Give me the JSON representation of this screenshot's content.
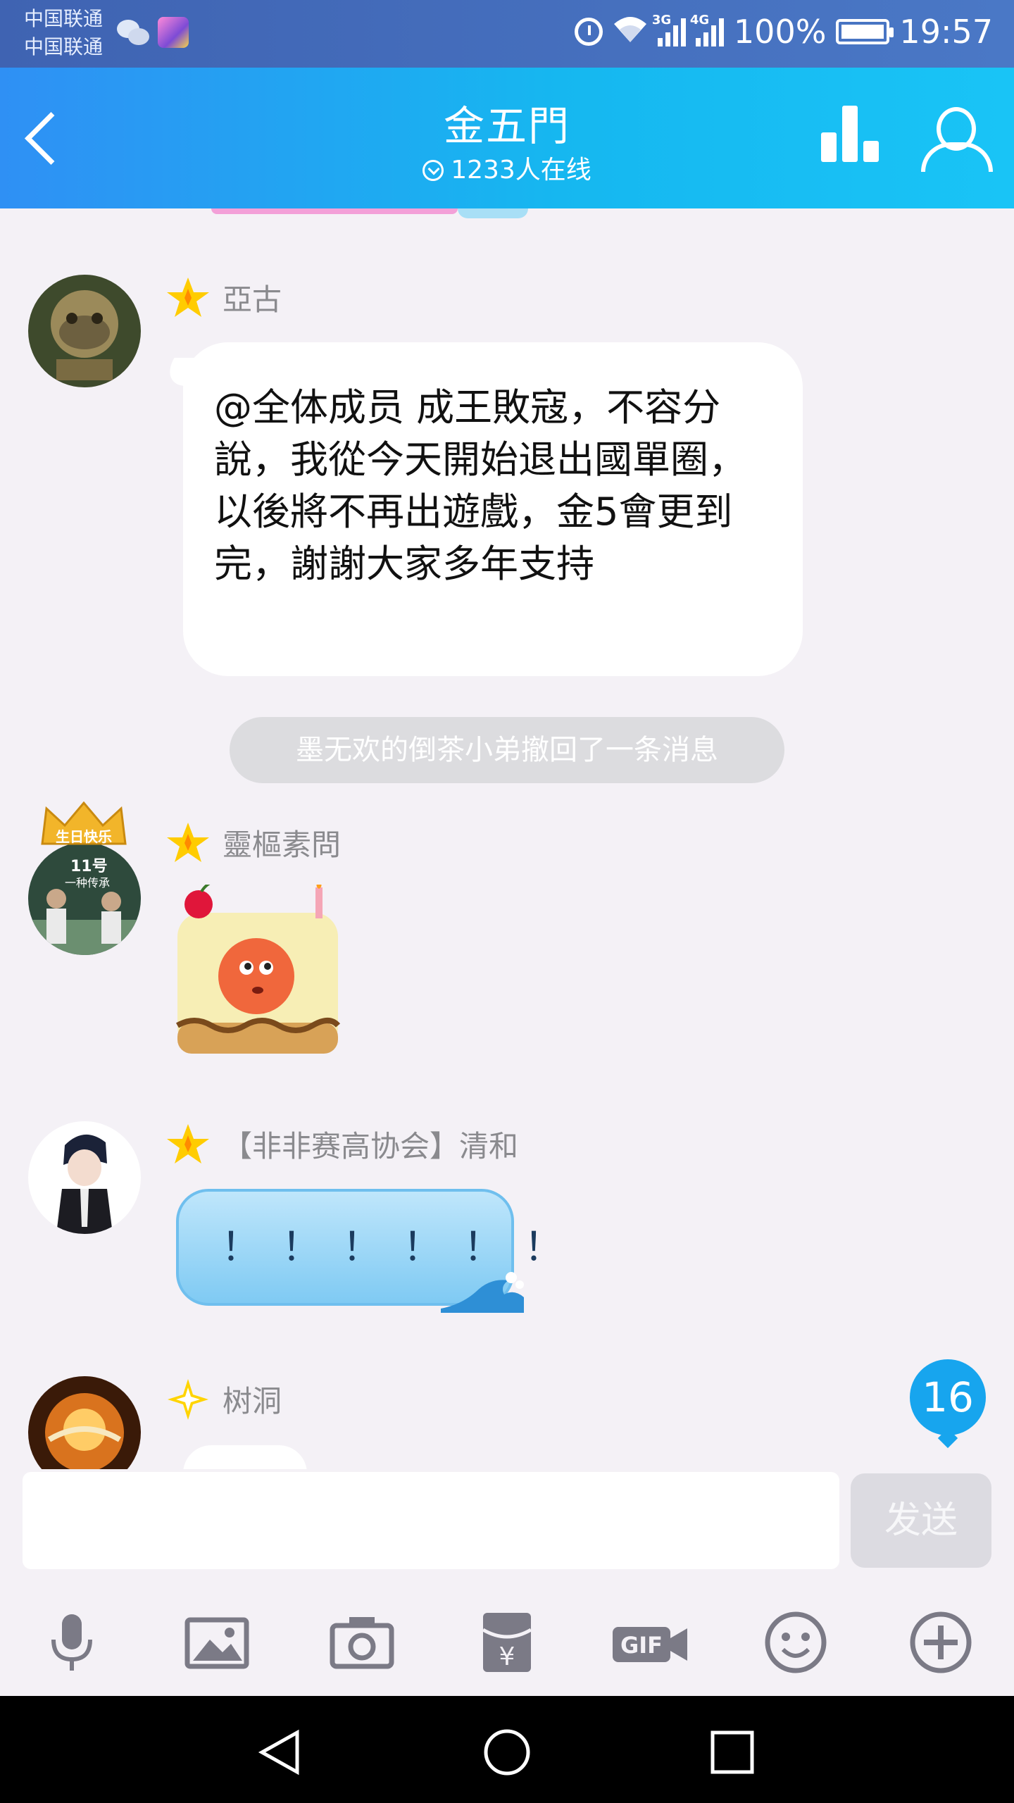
{
  "status_bar": {
    "carrier_1": "中国联通",
    "carrier_2": "中国联通",
    "signal_3g": "3G",
    "signal_4g": "4G",
    "battery": "100%",
    "time": "19:57"
  },
  "header": {
    "title": "金五門",
    "online": "1233人在线"
  },
  "messages": [
    {
      "nickname": "亞古",
      "text": "@全体成员 成王敗寇，不容分說，我從今天開始退出國單圈，以後將不再出遊戲，金5會更到完，謝謝大家多年支持"
    },
    {
      "system_notice": "墨无欢的倒茶小弟撤回了一条消息"
    },
    {
      "nickname": "靈樞素問",
      "avatar_crown_text": "生日快乐",
      "avatar_text_1": "11号",
      "avatar_text_2": "一种传承"
    },
    {
      "nickname": "【非非赛高协会】清和",
      "text": "！！！！！！"
    },
    {
      "nickname": "树洞"
    }
  ],
  "unread_count": "16",
  "input": {
    "value": "",
    "send_label": "发送"
  },
  "toolbar": {
    "gif_label": "GIF",
    "yen_label": "¥"
  },
  "colors": {
    "header_gradient_start": "#2f90f4",
    "header_gradient_end": "#19c4f6",
    "status_bar": "#4a6fbf",
    "background": "#f4f1f6",
    "unread_badge": "#17a5ee",
    "icon_gray": "#7b7a86"
  },
  "icons": [
    "back-icon",
    "stats-icon",
    "members-icon",
    "star-icon",
    "mic-icon",
    "image-icon",
    "camera-icon",
    "red-packet-icon",
    "gif-icon",
    "emoji-icon",
    "plus-icon",
    "nav-back-icon",
    "nav-home-icon",
    "nav-recent-icon"
  ]
}
